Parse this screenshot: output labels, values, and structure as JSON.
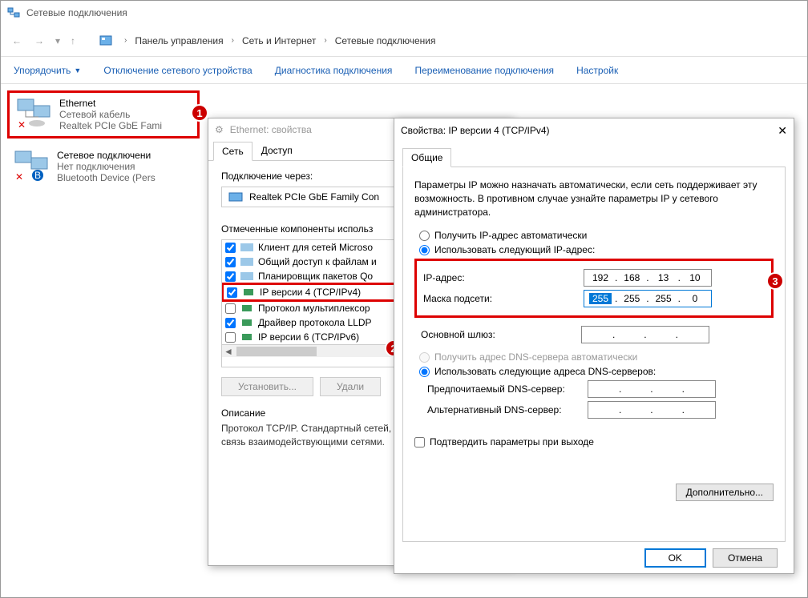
{
  "window": {
    "title": "Сетевые подключения"
  },
  "breadcrumb": {
    "items": [
      "Панель управления",
      "Сеть и Интернет",
      "Сетевые подключения"
    ]
  },
  "toolbar": {
    "organize": "Упорядочить",
    "disable": "Отключение сетевого устройства",
    "diagnose": "Диагностика подключения",
    "rename": "Переименование подключения",
    "settings": "Настройк"
  },
  "connections": [
    {
      "name": "Ethernet",
      "status": "Сетевой кабель",
      "device": "Realtek PCIe GbE Fami"
    },
    {
      "name": "Сетевое подключени",
      "status": "Нет подключения",
      "device": "Bluetooth Device (Pers"
    }
  ],
  "dlg1": {
    "title": "Ethernet: свойства",
    "tabs": [
      "Сеть",
      "Доступ"
    ],
    "connect_via_label": "Подключение через:",
    "nic": "Realtek PCIe GbE Family Con",
    "components_label": "Отмеченные компоненты использ",
    "components": [
      {
        "checked": true,
        "label": "Клиент для сетей Microso"
      },
      {
        "checked": true,
        "label": "Общий доступ к файлам и"
      },
      {
        "checked": true,
        "label": "Планировщик пакетов Qo"
      },
      {
        "checked": true,
        "label": "IP версии 4 (TCP/IPv4)"
      },
      {
        "checked": false,
        "label": "Протокол мультиплексор"
      },
      {
        "checked": true,
        "label": "Драйвер протокола LLDP"
      },
      {
        "checked": false,
        "label": "IP версии 6 (TCP/IPv6)"
      }
    ],
    "install_btn": "Установить...",
    "remove_btn": "Удали",
    "desc_label": "Описание",
    "desc_text": "Протокол TCP/IP. Стандартный сетей, обеспечивающий связь взаимодействующими сетями."
  },
  "dlg2": {
    "title": "Свойства: IP версии 4 (TCP/IPv4)",
    "tab": "Общие",
    "intro": "Параметры IP можно назначать автоматически, если сеть поддерживает эту возможность. В противном случае узнайте параметры IP у сетевого администратора.",
    "r_auto_ip": "Получить IP-адрес автоматически",
    "r_manual_ip": "Использовать следующий IP-адрес:",
    "ip_label": "IP-адрес:",
    "ip_value": [
      "192",
      "168",
      "13",
      "10"
    ],
    "mask_label": "Маска подсети:",
    "mask_value": [
      "255",
      "255",
      "255",
      "0"
    ],
    "gw_label": "Основной шлюз:",
    "gw_value": [
      "",
      "",
      "",
      ""
    ],
    "r_auto_dns": "Получить адрес DNS-сервера автоматически",
    "r_manual_dns": "Использовать следующие адреса DNS-серверов:",
    "dns1_label": "Предпочитаемый DNS-сервер:",
    "dns2_label": "Альтернативный DNS-сервер:",
    "confirm_exit": "Подтвердить параметры при выходе",
    "advanced": "Дополнительно...",
    "ok": "OK",
    "cancel": "Отмена"
  },
  "badges": {
    "b1": "1",
    "b2": "2",
    "b3": "3"
  }
}
